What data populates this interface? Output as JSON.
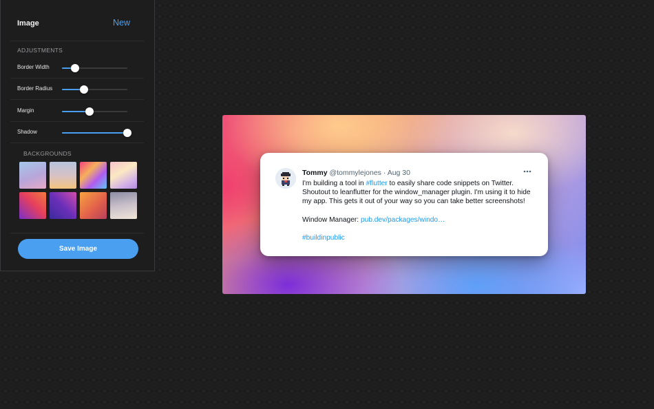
{
  "panel": {
    "title": "Image",
    "new_label": "New",
    "adjustments_label": "ADJUSTMENTS",
    "sliders": [
      {
        "label": "Border Width",
        "value": 0.2
      },
      {
        "label": "Border Radius",
        "value": 0.34
      },
      {
        "label": "Margin",
        "value": 0.42
      },
      {
        "label": "Shadow",
        "value": 1.0
      }
    ],
    "backgrounds_label": "BACKGROUNDS",
    "save_label": "Save Image"
  },
  "colors": {
    "accent": "#4a9ff0",
    "link": "#1d9bf0"
  },
  "tweet": {
    "name": "Tommy",
    "handle": "@tommylejones",
    "separator": "·",
    "date": "Aug 30",
    "line1_pre": "I'm building a tool in ",
    "line1_tag": "#flutter",
    "line1_post": " to easily share code snippets on Twitter. Shoutout to leanflutter for the window_manager plugin. I'm using it to hide my app. This gets it out of your way so you can take better screenshots!",
    "wm_label": "Window Manager: ",
    "wm_link": "pub.dev/packages/windo…",
    "hashtag": "#buildinpublic"
  }
}
